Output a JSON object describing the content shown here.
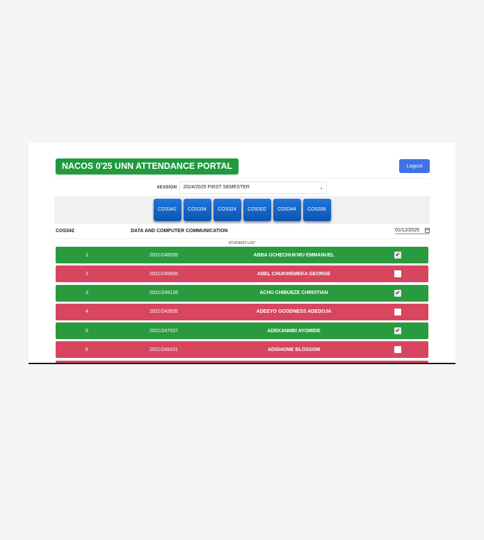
{
  "header": {
    "title": "NACOS 0'25 UNN ATTENDANCE PORTAL",
    "logout_label": "Logout"
  },
  "session": {
    "label": "SESSION",
    "selected": "2024/2025 FIRST SEMESTER"
  },
  "courses": [
    "COS342",
    "COS334",
    "COS324",
    "COS302",
    "COS344",
    "COS336"
  ],
  "course_info": {
    "code": "COS342",
    "name": "DATA AND COMPUTER COMMUNICATION",
    "date": "01/12/2025"
  },
  "student_list_title": "STUDENT LIST",
  "students": [
    {
      "num": "1",
      "reg": "2021/248539",
      "name": "ABBA UCHECHUKWU EMMANUEL",
      "present": true
    },
    {
      "num": "2",
      "reg": "2021/245835",
      "name": "ABEL CHUKWEMEKA GEORGE",
      "present": false
    },
    {
      "num": "3",
      "reg": "2021/249126",
      "name": "ACHU CHIBUEZE CHRISTIAN",
      "present": true
    },
    {
      "num": "4",
      "reg": "2021/242635",
      "name": "ADEEYO GOODNESS ADEDOJA",
      "present": false
    },
    {
      "num": "5",
      "reg": "2021/247537",
      "name": "ADEKANMBI AYOMIDE",
      "present": true
    },
    {
      "num": "6",
      "reg": "2021/249101",
      "name": "ADISHOME BLOSSOM",
      "present": false
    },
    {
      "num": "",
      "reg": "",
      "name": "",
      "present": false
    }
  ],
  "colors": {
    "present": "#2a9a3f",
    "absent": "#d7455f",
    "title_bg": "#1f9a3e",
    "logout_bg": "#3f73e6",
    "course_btn": "#1d76dc"
  }
}
